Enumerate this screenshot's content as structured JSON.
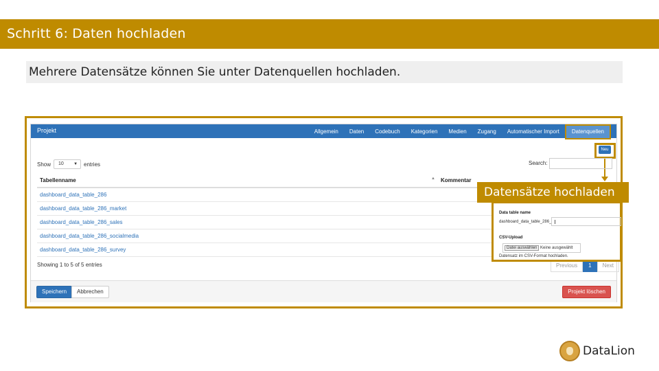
{
  "slide": {
    "banner": "Schritt 6: Daten hochladen",
    "subtitle": "Mehrere Datensätze können Sie unter Datenquellen hochladen.",
    "callout": "Datensätze hochladen",
    "logo": "DataLion"
  },
  "panel": {
    "title": "Projekt",
    "nav": [
      "Allgemein",
      "Daten",
      "Codebuch",
      "Kategorien",
      "Medien",
      "Zugang",
      "Automatischer Import",
      "Datenquellen"
    ],
    "active_tab": "Datenquellen",
    "new_button": "Neu",
    "show_label": "Show",
    "entries_value": "10",
    "entries_label": "entries",
    "search_label": "Search:",
    "columns": [
      "Tabellenname",
      "Kommentar"
    ],
    "rows": [
      "dashboard_data_table_286",
      "dashboard_data_table_286_market",
      "dashboard_data_table_286_sales",
      "dashboard_data_table_286_socialmedia",
      "dashboard_data_table_286_survey"
    ],
    "showing": "Showing 1 to 5 of 5 entries",
    "pager": {
      "prev": "Previous",
      "current": "1",
      "next": "Next"
    },
    "save_button": "Speichern",
    "cancel_button": "Abbrechen",
    "delete_button": "Projekt löschen"
  },
  "popup": {
    "name_label": "Data table name",
    "name_prefix": "dashboard_data_table_286_",
    "upload_label": "CSV-Upload",
    "file_button": "Datei auswählen",
    "file_status": "Keine ausgewählt",
    "hint": "Datensatz im CSV-Format hochladen."
  },
  "colors": {
    "accent": "#bf8b00",
    "primary": "#2e72b8",
    "danger": "#d9534f"
  }
}
